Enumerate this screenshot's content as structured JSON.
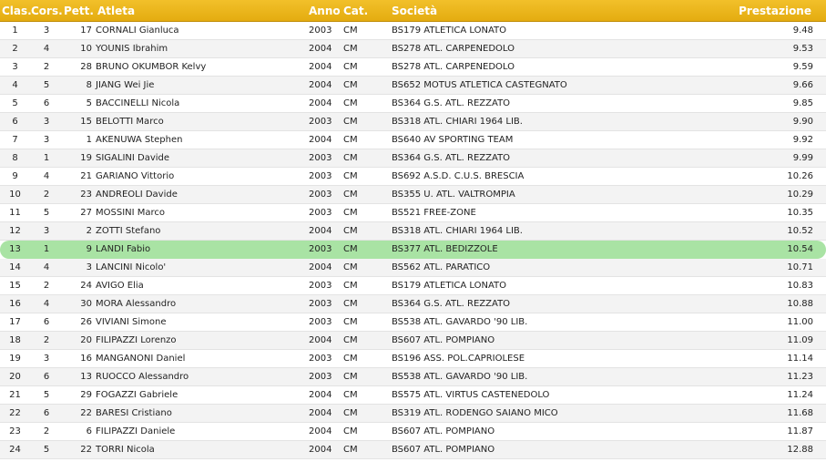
{
  "colors": {
    "header_bg": "#e9b216",
    "header_text": "#ffffff",
    "highlight_row": "#a9e3a4",
    "alt_row": "#f3f3f3"
  },
  "headers": {
    "clas": "Clas.",
    "cors": "Cors.",
    "pett": "Pett.",
    "atleta": "Atleta",
    "anno": "Anno",
    "cat": "Cat.",
    "societa": "Società",
    "prestazione": "Prestazione"
  },
  "rows": [
    {
      "clas": "1",
      "cors": "3",
      "pett": "17",
      "atleta": "CORNALI Gianluca",
      "anno": "2003",
      "cat": "CM",
      "societa": "BS179 ATLETICA LONATO",
      "prestazione": "9.48"
    },
    {
      "clas": "2",
      "cors": "4",
      "pett": "10",
      "atleta": "YOUNIS Ibrahim",
      "anno": "2004",
      "cat": "CM",
      "societa": "BS278 ATL. CARPENEDOLO",
      "prestazione": "9.53"
    },
    {
      "clas": "3",
      "cors": "2",
      "pett": "28",
      "atleta": "BRUNO OKUMBOR Kelvy",
      "anno": "2004",
      "cat": "CM",
      "societa": "BS278 ATL. CARPENEDOLO",
      "prestazione": "9.59"
    },
    {
      "clas": "4",
      "cors": "5",
      "pett": "8",
      "atleta": "JIANG Wei Jie",
      "anno": "2004",
      "cat": "CM",
      "societa": "BS652 MOTUS ATLETICA CASTEGNATO",
      "prestazione": "9.66"
    },
    {
      "clas": "5",
      "cors": "6",
      "pett": "5",
      "atleta": "BACCINELLI Nicola",
      "anno": "2004",
      "cat": "CM",
      "societa": "BS364 G.S. ATL. REZZATO",
      "prestazione": "9.85"
    },
    {
      "clas": "6",
      "cors": "3",
      "pett": "15",
      "atleta": "BELOTTI Marco",
      "anno": "2003",
      "cat": "CM",
      "societa": "BS318 ATL. CHIARI 1964 LIB.",
      "prestazione": "9.90"
    },
    {
      "clas": "7",
      "cors": "3",
      "pett": "1",
      "atleta": "AKENUWA Stephen",
      "anno": "2004",
      "cat": "CM",
      "societa": "BS640 AV SPORTING TEAM",
      "prestazione": "9.92"
    },
    {
      "clas": "8",
      "cors": "1",
      "pett": "19",
      "atleta": "SIGALINI Davide",
      "anno": "2003",
      "cat": "CM",
      "societa": "BS364 G.S. ATL. REZZATO",
      "prestazione": "9.99"
    },
    {
      "clas": "9",
      "cors": "4",
      "pett": "21",
      "atleta": "GARIANO Vittorio",
      "anno": "2003",
      "cat": "CM",
      "societa": "BS692 A.S.D. C.U.S. BRESCIA",
      "prestazione": "10.26"
    },
    {
      "clas": "10",
      "cors": "2",
      "pett": "23",
      "atleta": "ANDREOLI Davide",
      "anno": "2003",
      "cat": "CM",
      "societa": "BS355 U. ATL. VALTROMPIA",
      "prestazione": "10.29"
    },
    {
      "clas": "11",
      "cors": "5",
      "pett": "27",
      "atleta": "MOSSINI Marco",
      "anno": "2003",
      "cat": "CM",
      "societa": "BS521 FREE-ZONE",
      "prestazione": "10.35"
    },
    {
      "clas": "12",
      "cors": "3",
      "pett": "2",
      "atleta": "ZOTTI Stefano",
      "anno": "2004",
      "cat": "CM",
      "societa": "BS318 ATL. CHIARI 1964 LIB.",
      "prestazione": "10.52"
    },
    {
      "clas": "13",
      "cors": "1",
      "pett": "9",
      "atleta": "LANDI Fabio",
      "anno": "2003",
      "cat": "CM",
      "societa": "BS377 ATL. BEDIZZOLE",
      "prestazione": "10.54",
      "highlight": true
    },
    {
      "clas": "14",
      "cors": "4",
      "pett": "3",
      "atleta": "LANCINI Nicolo'",
      "anno": "2004",
      "cat": "CM",
      "societa": "BS562 ATL. PARATICO",
      "prestazione": "10.71"
    },
    {
      "clas": "15",
      "cors": "2",
      "pett": "24",
      "atleta": "AVIGO Elia",
      "anno": "2003",
      "cat": "CM",
      "societa": "BS179 ATLETICA LONATO",
      "prestazione": "10.83"
    },
    {
      "clas": "16",
      "cors": "4",
      "pett": "30",
      "atleta": "MORA Alessandro",
      "anno": "2003",
      "cat": "CM",
      "societa": "BS364 G.S. ATL. REZZATO",
      "prestazione": "10.88"
    },
    {
      "clas": "17",
      "cors": "6",
      "pett": "26",
      "atleta": "VIVIANI Simone",
      "anno": "2003",
      "cat": "CM",
      "societa": "BS538 ATL. GAVARDO '90 LIB.",
      "prestazione": "11.00"
    },
    {
      "clas": "18",
      "cors": "2",
      "pett": "20",
      "atleta": "FILIPAZZI Lorenzo",
      "anno": "2004",
      "cat": "CM",
      "societa": "BS607 ATL. POMPIANO",
      "prestazione": "11.09"
    },
    {
      "clas": "19",
      "cors": "3",
      "pett": "16",
      "atleta": "MANGANONI Daniel",
      "anno": "2003",
      "cat": "CM",
      "societa": "BS196 ASS. POL.CAPRIOLESE",
      "prestazione": "11.14"
    },
    {
      "clas": "20",
      "cors": "6",
      "pett": "13",
      "atleta": "RUOCCO Alessandro",
      "anno": "2003",
      "cat": "CM",
      "societa": "BS538 ATL. GAVARDO '90 LIB.",
      "prestazione": "11.23"
    },
    {
      "clas": "21",
      "cors": "5",
      "pett": "29",
      "atleta": "FOGAZZI Gabriele",
      "anno": "2004",
      "cat": "CM",
      "societa": "BS575 ATL. VIRTUS CASTENEDOLO",
      "prestazione": "11.24"
    },
    {
      "clas": "22",
      "cors": "6",
      "pett": "22",
      "atleta": "BARESI Cristiano",
      "anno": "2004",
      "cat": "CM",
      "societa": "BS319 ATL. RODENGO SAIANO MICO",
      "prestazione": "11.68"
    },
    {
      "clas": "23",
      "cors": "2",
      "pett": "6",
      "atleta": "FILIPAZZI Daniele",
      "anno": "2004",
      "cat": "CM",
      "societa": "BS607 ATL. POMPIANO",
      "prestazione": "11.87"
    },
    {
      "clas": "24",
      "cors": "5",
      "pett": "22",
      "atleta": "TORRI Nicola",
      "anno": "2004",
      "cat": "CM",
      "societa": "BS607 ATL. POMPIANO",
      "prestazione": "12.88"
    }
  ]
}
